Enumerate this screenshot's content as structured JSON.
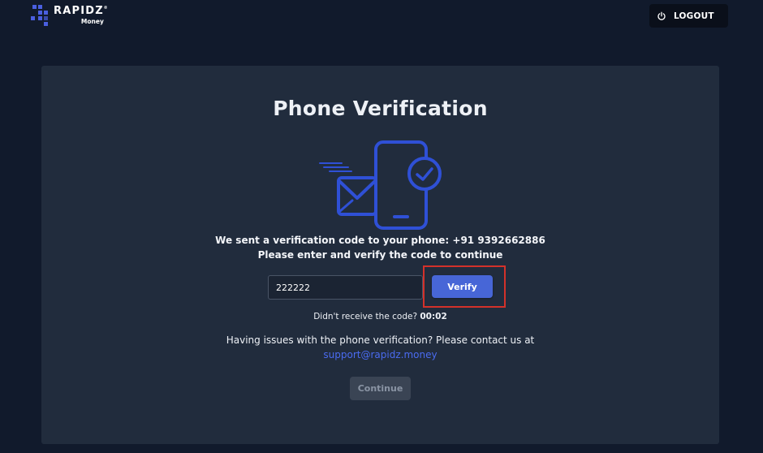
{
  "header": {
    "logo": {
      "name": "RAPIDZ",
      "sub": "Money",
      "registered": "®"
    },
    "logout_label": "LOGOUT"
  },
  "verification": {
    "title": "Phone Verification",
    "sent_prefix": "We sent a verification code to your phone: ",
    "phone": "+91 9392662886",
    "instruction": "Please enter and verify the code to continue",
    "code_value": "222222",
    "verify_label": "Verify",
    "resend_prefix": "Didn't receive the code? ",
    "timer": "00:02",
    "issues_text": "Having issues with the phone verification? Please contact us at",
    "support_email": "support@rapidz.money",
    "continue_label": "Continue"
  },
  "icons": {
    "logout": "power-icon",
    "illustration": "phone-verification-illustration",
    "envelope": "envelope-icon",
    "check": "check-circle-icon"
  },
  "colors": {
    "page_bg": "#111a2c",
    "card_bg": "#212c3d",
    "accent": "#4766d7",
    "link": "#4a6bf0",
    "highlight": "#d3312a"
  }
}
